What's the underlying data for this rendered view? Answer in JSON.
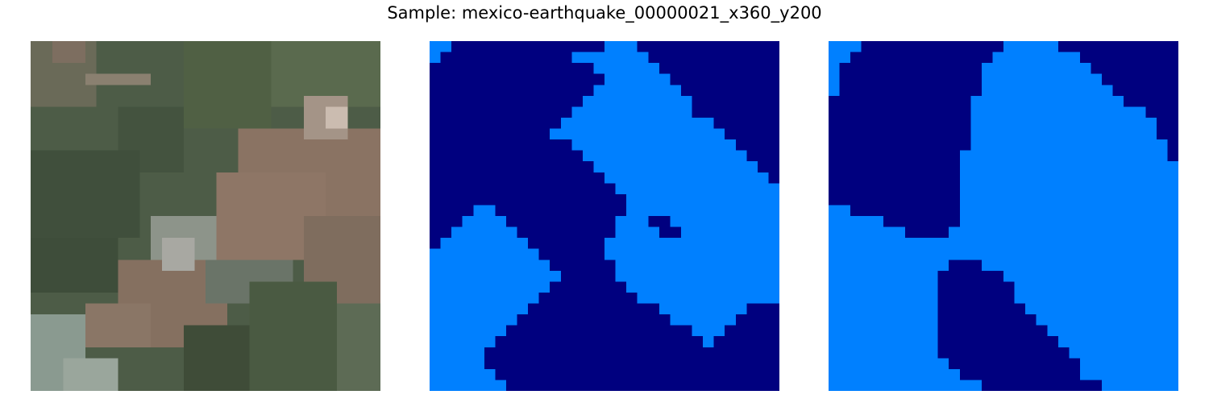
{
  "figure": {
    "title": "Sample: mexico-earthquake_00000021_x360_y200"
  },
  "panels": [
    {
      "name": "satellite-image",
      "kind": "rgb-image"
    },
    {
      "name": "segmentation-mask-1",
      "kind": "binary-mask"
    },
    {
      "name": "segmentation-mask-2",
      "kind": "binary-mask"
    }
  ],
  "colors": {
    "mask_background": "#00007f",
    "mask_foreground": "#0080ff",
    "image_vegetation": "#4a5a44",
    "image_soil": "#8a7464",
    "image_concrete": "#9aa29a"
  }
}
